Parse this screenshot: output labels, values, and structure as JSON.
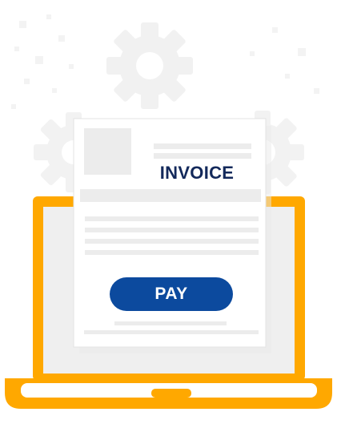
{
  "invoice": {
    "title": "INVOICE",
    "pay_label": "PAY"
  },
  "icons": [
    "gear-icon",
    "laptop-icon",
    "invoice-document-icon"
  ],
  "colors": {
    "laptop_frame": "#ffa800",
    "laptop_screen": "#efefef",
    "pay_button": "#0c4a9e",
    "invoice_title": "#13295b",
    "placeholder": "#ececec",
    "gear": "#f1f1f1"
  }
}
